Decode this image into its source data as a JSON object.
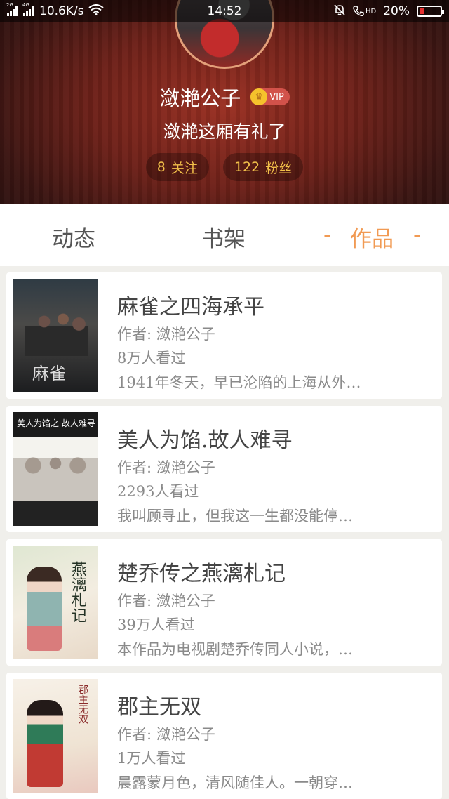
{
  "status_bar": {
    "network_left": "2G",
    "network_right": "4G",
    "speed": "10.6K/s",
    "time": "14:52",
    "hd": "HD",
    "battery": "20%"
  },
  "profile": {
    "name": "潋滟公子",
    "vip_label": "VIP",
    "motto": "潋滟这厢有礼了",
    "following_count": "8",
    "following_label": "关注",
    "fans_count": "122",
    "fans_label": "粉丝"
  },
  "tabs": {
    "dynamic": "动态",
    "bookshelf": "书架",
    "works": "作品",
    "active_dash": "-"
  },
  "works": [
    {
      "title": "麻雀之四海承平",
      "author": "作者: 潋滟公子",
      "views": "8万人看过",
      "summary": "1941年冬天，早已沦陷的上海从外…",
      "cover_text": "麻雀"
    },
    {
      "title": "美人为馅.故人难寻",
      "author": "作者: 潋滟公子",
      "views": "2293人看过",
      "summary": "我叫顾寻止，但我这一生都没能停…",
      "cover_text": "美人为馅之 故人难寻"
    },
    {
      "title": "楚乔传之燕漓札记",
      "author": "作者: 潋滟公子",
      "views": "39万人看过",
      "summary": "本作品为电视剧楚乔传同人小说，…",
      "cover_text": "燕漓札记"
    },
    {
      "title": "郡主无双",
      "author": "作者: 潋滟公子",
      "views": "1万人看过",
      "summary": "晨露蒙月色，清风随佳人。一朝穿…",
      "cover_text": "郡主无双"
    }
  ]
}
